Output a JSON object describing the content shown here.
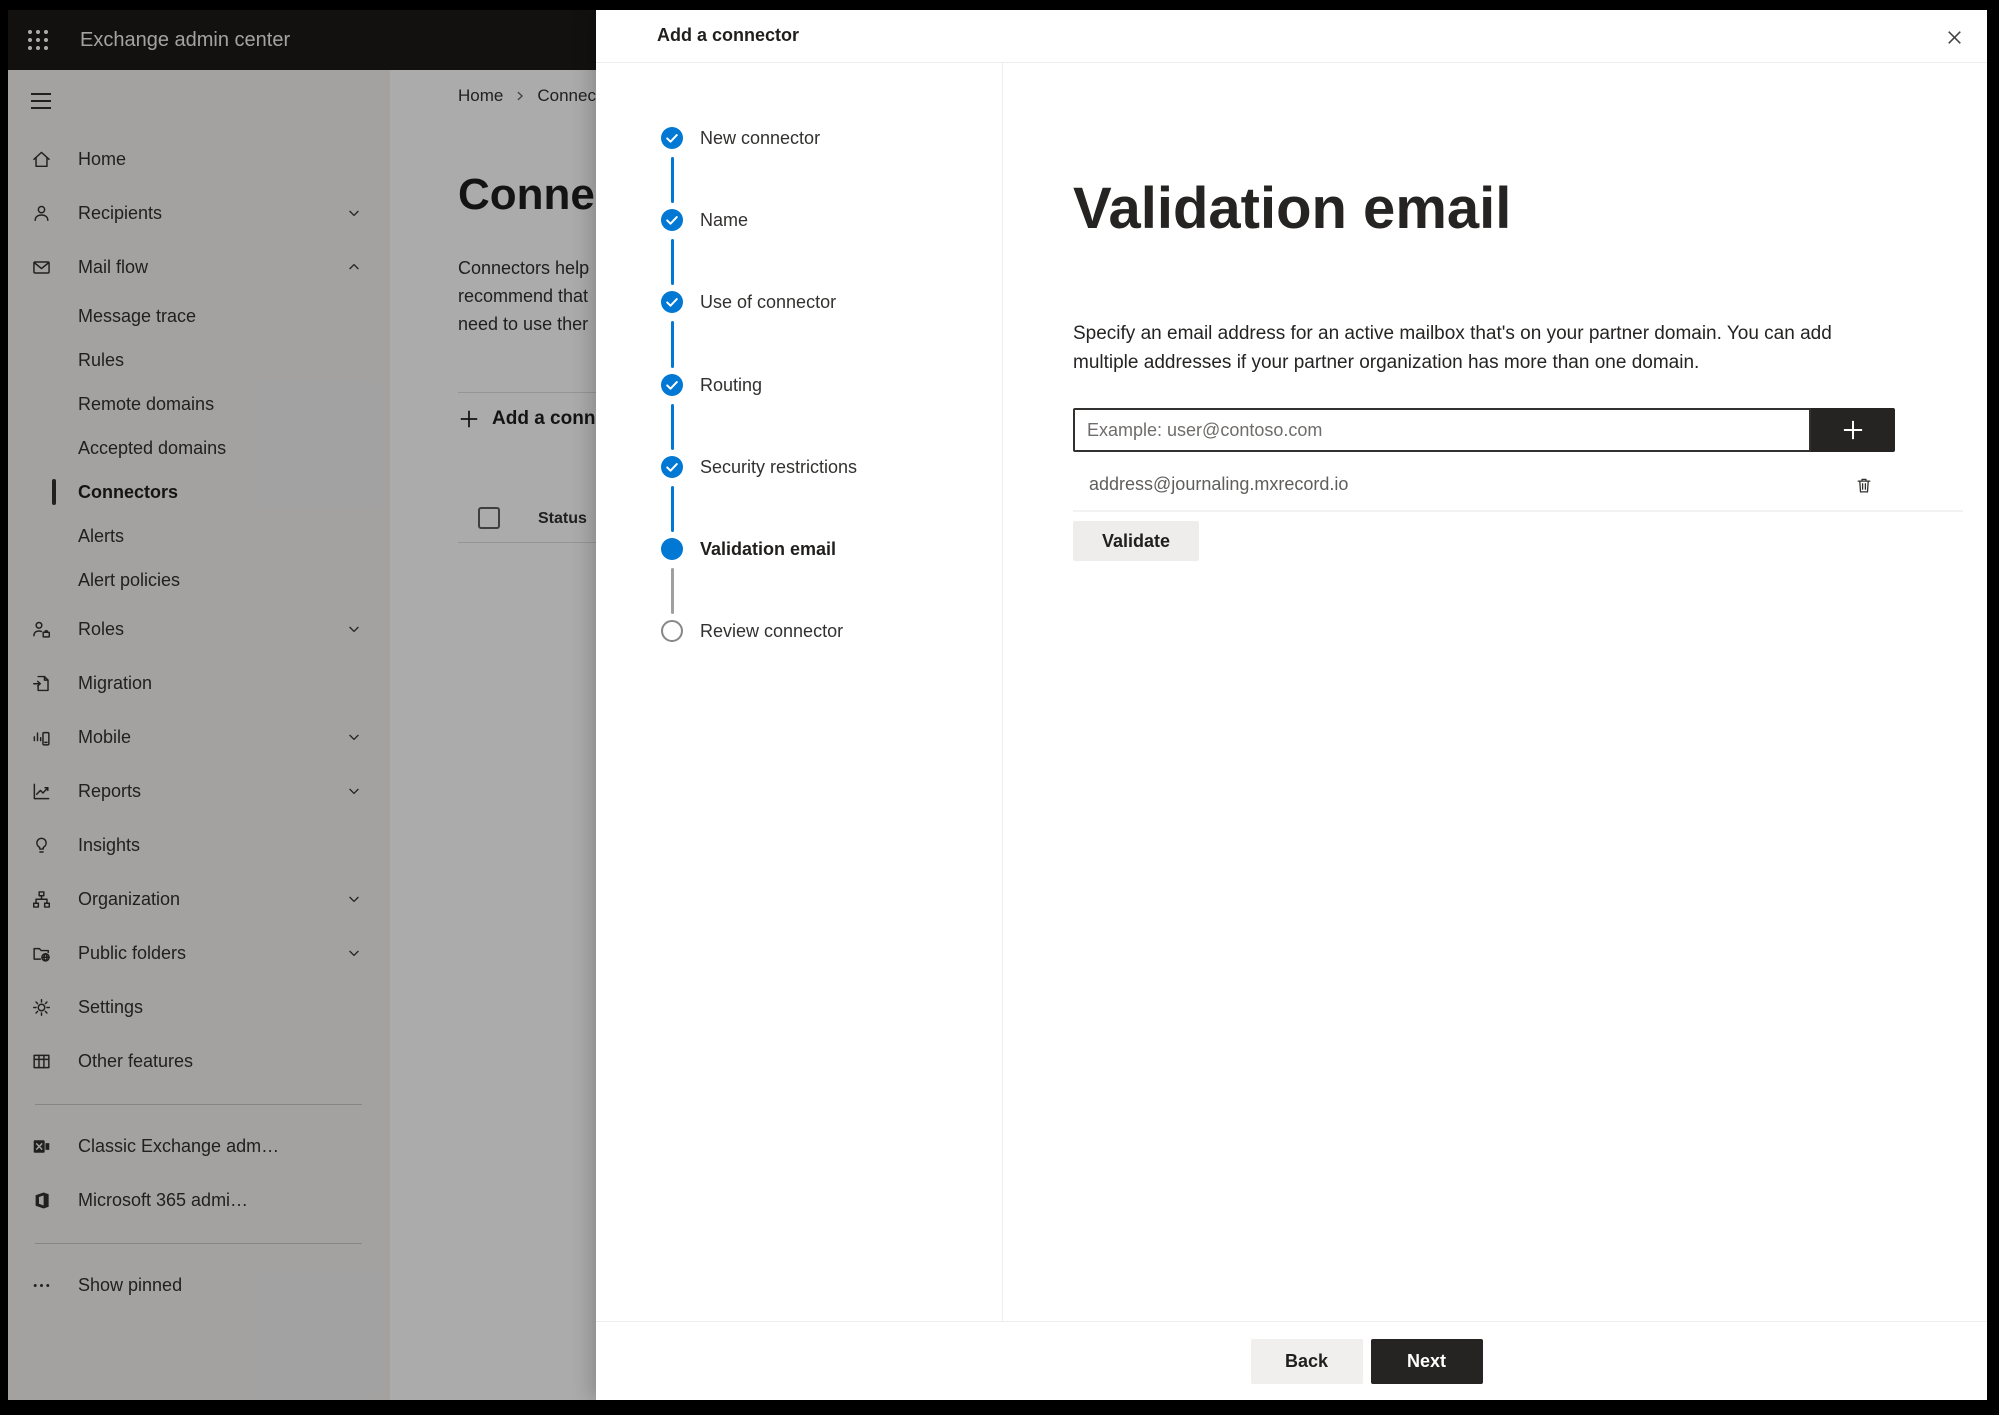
{
  "colors": {
    "accent_blue": "#0078d4",
    "topbar_bg": "#1b1a19",
    "dark_button_bg": "#252423",
    "sidebar_bg": "#f3f2f1",
    "panel_bg": "#ffffff"
  },
  "topbar": {
    "title": "Exchange admin center"
  },
  "sidebar": {
    "items": [
      {
        "label": "Home",
        "icon": "home"
      },
      {
        "label": "Recipients",
        "icon": "recipients",
        "chevron": "down"
      },
      {
        "label": "Mail flow",
        "icon": "mail-flow",
        "chevron": "up"
      },
      {
        "label": "Message trace",
        "sub": true
      },
      {
        "label": "Rules",
        "sub": true
      },
      {
        "label": "Remote domains",
        "sub": true
      },
      {
        "label": "Accepted domains",
        "sub": true
      },
      {
        "label": "Connectors",
        "sub": true,
        "selected": true
      },
      {
        "label": "Alerts",
        "sub": true
      },
      {
        "label": "Alert policies",
        "sub": true
      },
      {
        "label": "Roles",
        "icon": "roles",
        "chevron": "down"
      },
      {
        "label": "Migration",
        "icon": "migration"
      },
      {
        "label": "Mobile",
        "icon": "mobile",
        "chevron": "down"
      },
      {
        "label": "Reports",
        "icon": "reports",
        "chevron": "down"
      },
      {
        "label": "Insights",
        "icon": "insights"
      },
      {
        "label": "Organization",
        "icon": "organization",
        "chevron": "down"
      },
      {
        "label": "Public folders",
        "icon": "public-folders",
        "chevron": "down"
      },
      {
        "label": "Settings",
        "icon": "settings"
      },
      {
        "label": "Other features",
        "icon": "other-features"
      }
    ],
    "footer_items": [
      {
        "label": "Classic Exchange adm…",
        "icon": "classic-exchange"
      },
      {
        "label": "Microsoft 365 admi…",
        "icon": "microsoft-365"
      }
    ],
    "show_pinned": {
      "label": "Show pinned",
      "icon": "ellipsis"
    }
  },
  "background_page": {
    "breadcrumb": {
      "home": "Home",
      "current": "Connectors"
    },
    "title": "Connectors",
    "description_lines": [
      "Connectors help",
      "recommend that",
      "need to use ther"
    ],
    "add_button": "Add a connector",
    "table": {
      "status_header": "Status"
    }
  },
  "panel": {
    "title": "Add a connector",
    "steps": [
      {
        "label": "New connector",
        "state": "completed"
      },
      {
        "label": "Name",
        "state": "completed"
      },
      {
        "label": "Use of connector",
        "state": "completed"
      },
      {
        "label": "Routing",
        "state": "completed"
      },
      {
        "label": "Security restrictions",
        "state": "completed"
      },
      {
        "label": "Validation email",
        "state": "current"
      },
      {
        "label": "Review connector",
        "state": "upcoming"
      }
    ],
    "content": {
      "heading": "Validation email",
      "description": "Specify an email address for an active mailbox that's on your partner domain. You can add multiple addresses if your partner organization has more than one domain.",
      "email_input": {
        "value": "",
        "placeholder": "Example: user@contoso.com"
      },
      "addresses": [
        {
          "email": "address@journaling.mxrecord.io"
        }
      ],
      "validate_button": "Validate"
    },
    "footer": {
      "back_button": "Back",
      "next_button": "Next"
    }
  }
}
